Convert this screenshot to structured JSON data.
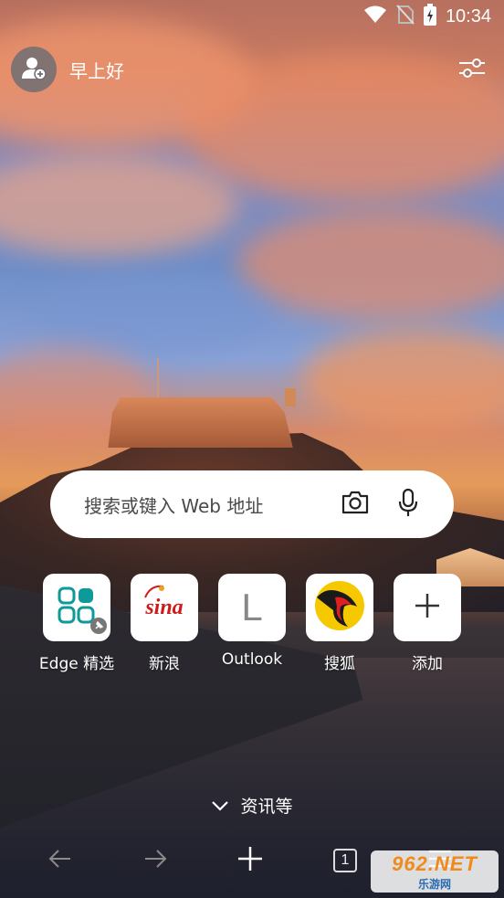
{
  "status_bar": {
    "time": "10:34",
    "icons": [
      "wifi-icon",
      "no-sim-icon",
      "battery-charging-icon"
    ]
  },
  "header": {
    "greeting": "早上好",
    "avatar_icon": "add-profile-icon",
    "settings_icon": "sliders-icon"
  },
  "search": {
    "placeholder": "搜索或键入 Web 地址",
    "camera_icon": "camera-icon",
    "mic_icon": "microphone-icon"
  },
  "shortcuts": [
    {
      "label": "Edge 精选",
      "icon": "edge-collections-icon"
    },
    {
      "label": "新浪",
      "icon": "sina-logo",
      "logo_text": "sina"
    },
    {
      "label": "Outlook",
      "icon": "letter-l-icon",
      "logo_text": "L"
    },
    {
      "label": "搜狐",
      "icon": "sohu-fox-icon"
    },
    {
      "label": "添加",
      "icon": "plus-icon"
    }
  ],
  "news": {
    "label": "资讯等",
    "icon": "chevron-down-icon"
  },
  "bottom_nav": {
    "tab_count": "1",
    "icons": [
      "back-arrow-icon",
      "forward-arrow-icon",
      "new-tab-plus-icon",
      "tabs-icon",
      "menu-icon"
    ]
  },
  "watermark": {
    "number": "962.NET",
    "subtitle": "乐游网"
  },
  "colors": {
    "accent_red": "#d01a1a",
    "edge_teal": "#0f9a9a",
    "sohu_yellow": "#f5c800"
  }
}
